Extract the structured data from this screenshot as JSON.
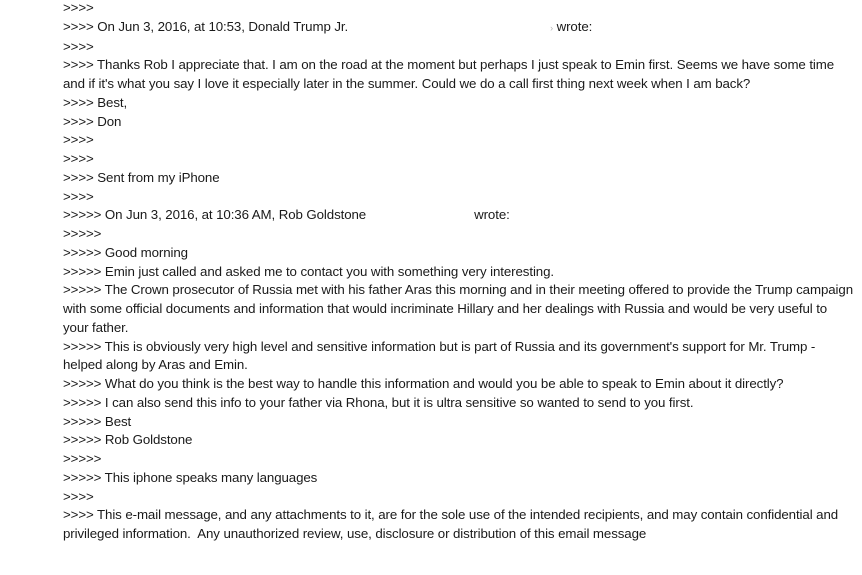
{
  "document": {
    "type": "scanned email thread",
    "lines": [
      ">>>>",
      ">>>> On Jun 3, 2016, at 10:53, Donald Trump Jr.",
      ">>>>",
      ">>>> Thanks Rob I appreciate that. I am on the road at the moment but perhaps I just speak to Emin first. Seems we have some time and if it's what you say I love it especially later in the summer. Could we do a call first thing next week when I am back?",
      ">>>> Best,",
      ">>>> Don",
      ">>>>",
      ">>>>",
      ">>>> Sent from my iPhone",
      ">>>>",
      ">>>>> On Jun 3, 2016, at 10:36 AM, Rob Goldstone",
      ">>>>>",
      ">>>>> Good morning",
      ">>>>> Emin just called and asked me to contact you with something very interesting.",
      ">>>>> The Crown prosecutor of Russia met with his father Aras this morning and in their meeting offered to provide the Trump campaign with some official documents and information that would incriminate Hillary and her dealings with Russia and would be very useful to your father.",
      ">>>>> This is obviously very high level and sensitive information but is part of Russia and its government's support for Mr. Trump - helped along by Aras and Emin.",
      ">>>>> What do you think is the best way to handle this information and would you be able to speak to Emin about it directly?",
      ">>>>> I can also send this info to your father via Rhona, but it is ultra sensitive so wanted to send to you first.",
      ">>>>> Best",
      ">>>>> Rob Goldstone",
      ">>>>>",
      ">>>>> This iphone speaks many languages",
      ">>>>",
      ">>>> This e-mail message, and any attachments to it, are for the sole use of the intended recipients, and may contain confidential and privileged information.  Any unauthorized review, use, disclosure or distribution of this email message"
    ],
    "header_suffixes": {
      "don_wrote": "wrote:",
      "don_mark": "›",
      "rob_wrote": "wrote:"
    }
  }
}
